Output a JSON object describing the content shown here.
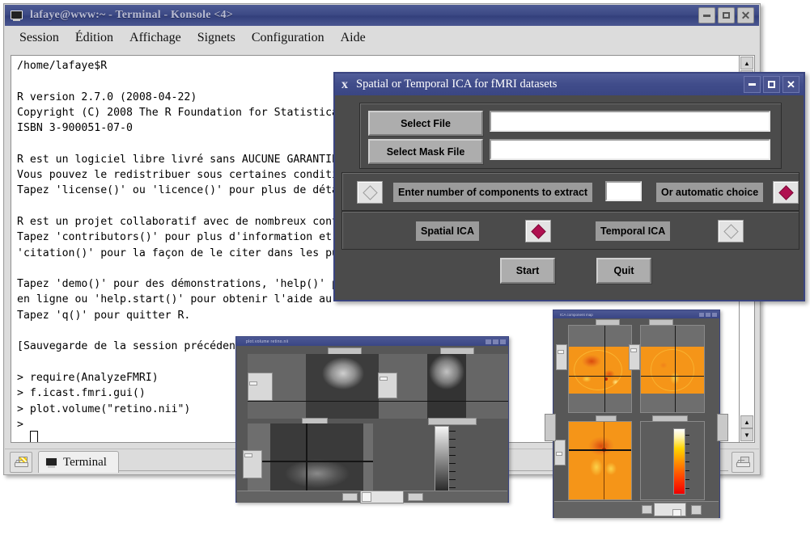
{
  "konsole": {
    "title": "lafaye@www:~ - Terminal - Konsole <4>",
    "icon": "terminal-icon",
    "menu": [
      "Session",
      "Édition",
      "Affichage",
      "Signets",
      "Configuration",
      "Aide"
    ],
    "terminal_text": "/home/lafaye$R\n\nR version 2.7.0 (2008-04-22)\nCopyright (C) 2008 The R Foundation for Statistica\nISBN 3-900051-07-0\n\nR est un logiciel libre livré sans AUCUNE GARANTIE\nVous pouvez le redistribuer sous certaines conditi\nTapez 'license()' ou 'licence()' pour plus de déta\n\nR est un projet collaboratif avec de nombreux cont\nTapez 'contributors()' pour plus d'information et\n'citation()' pour la façon de le citer dans les pu\n\nTapez 'demo()' pour des démonstrations, 'help()' p\nen ligne ou 'help.start()' pour obtenir l'aide au\nTapez 'q()' pour quitter R.\n\n[Sauvegarde de la session précédente restaurée]\n\n> require(AnalyzeFMRI)\n> f.icast.fmri.gui()\n> plot.volume(\"retino.nii\")\n> ",
    "tab_label": "Terminal",
    "new_session_icon": "new-session-icon",
    "bookmark_icon": "new-session-icon",
    "window_buttons": {
      "minimize": "–",
      "maximize": "□",
      "close": "✕"
    },
    "scrollbar": {
      "up_arrow": "▲",
      "down_arrow": "▼"
    }
  },
  "ica_dialog": {
    "title": "Spatial or Temporal ICA for fMRI datasets",
    "app_icon": "x-logo-icon",
    "select_file_button": "Select File",
    "select_file_value": "",
    "select_file_placeholder": "",
    "select_mask_button": "Select Mask File",
    "select_mask_value": "",
    "select_mask_placeholder": "",
    "components_radio_selected": false,
    "components_label": "Enter number of components to extract",
    "components_value": "",
    "automatic_label": "Or automatic choice",
    "automatic_radio_selected": true,
    "spatial_ica_label": "Spatial ICA",
    "spatial_ica_selected": true,
    "temporal_ica_label": "Temporal ICA",
    "temporal_ica_selected": false,
    "start_button": "Start",
    "quit_button": "Quit",
    "window_buttons": {
      "minimize": "–",
      "maximize": "□",
      "close": "✕"
    },
    "accent_color": "#b01050",
    "titlebar_color": "#3a4684"
  },
  "volume_viewer": {
    "title": "plot.volume retino.nii",
    "panels": [
      "Sagittal",
      "Coronal",
      "Axial",
      "Color scale"
    ],
    "colormap": "grayscale",
    "window_buttons": {
      "minimize": "–",
      "maximize": "□",
      "close": "✕"
    }
  },
  "ica_map_viewer": {
    "title": "ICA component map",
    "panels": [
      "Sagittal",
      "Coronal",
      "Axial",
      "Color scale"
    ],
    "colormap": "hot",
    "window_buttons": {
      "minimize": "–",
      "maximize": "□",
      "close": "✕"
    }
  }
}
